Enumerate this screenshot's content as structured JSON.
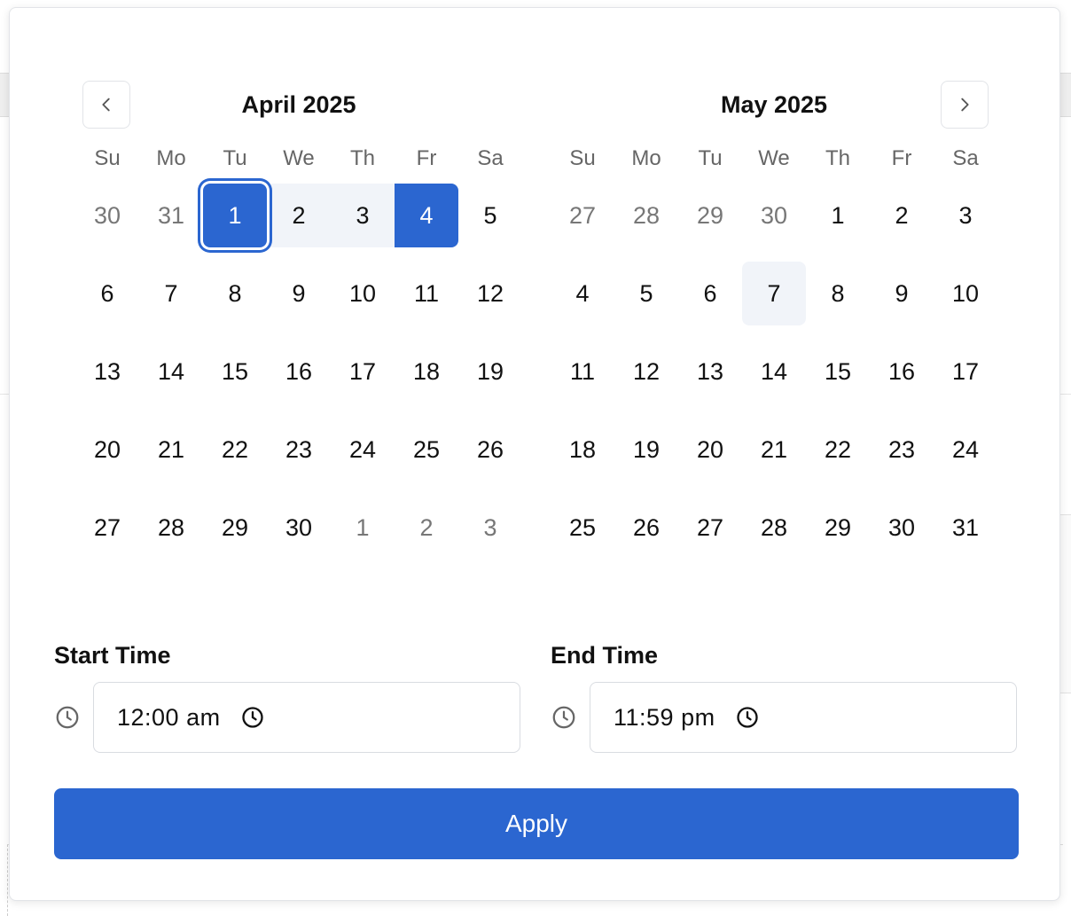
{
  "calendar": {
    "weekdays": [
      "Su",
      "Mo",
      "Tu",
      "We",
      "Th",
      "Fr",
      "Sa"
    ],
    "months": [
      {
        "title": "April 2025",
        "days": [
          {
            "label": "30",
            "state": "outside"
          },
          {
            "label": "31",
            "state": "outside"
          },
          {
            "label": "1",
            "state": "range-start"
          },
          {
            "label": "2",
            "state": "in-range"
          },
          {
            "label": "3",
            "state": "in-range"
          },
          {
            "label": "4",
            "state": "range-end"
          },
          {
            "label": "5",
            "state": ""
          },
          {
            "label": "6",
            "state": ""
          },
          {
            "label": "7",
            "state": ""
          },
          {
            "label": "8",
            "state": ""
          },
          {
            "label": "9",
            "state": ""
          },
          {
            "label": "10",
            "state": ""
          },
          {
            "label": "11",
            "state": ""
          },
          {
            "label": "12",
            "state": ""
          },
          {
            "label": "13",
            "state": ""
          },
          {
            "label": "14",
            "state": ""
          },
          {
            "label": "15",
            "state": ""
          },
          {
            "label": "16",
            "state": ""
          },
          {
            "label": "17",
            "state": ""
          },
          {
            "label": "18",
            "state": ""
          },
          {
            "label": "19",
            "state": ""
          },
          {
            "label": "20",
            "state": ""
          },
          {
            "label": "21",
            "state": ""
          },
          {
            "label": "22",
            "state": ""
          },
          {
            "label": "23",
            "state": ""
          },
          {
            "label": "24",
            "state": ""
          },
          {
            "label": "25",
            "state": ""
          },
          {
            "label": "26",
            "state": ""
          },
          {
            "label": "27",
            "state": ""
          },
          {
            "label": "28",
            "state": ""
          },
          {
            "label": "29",
            "state": ""
          },
          {
            "label": "30",
            "state": ""
          },
          {
            "label": "1",
            "state": "outside"
          },
          {
            "label": "2",
            "state": "outside"
          },
          {
            "label": "3",
            "state": "outside"
          }
        ]
      },
      {
        "title": "May 2025",
        "days": [
          {
            "label": "27",
            "state": "outside"
          },
          {
            "label": "28",
            "state": "outside"
          },
          {
            "label": "29",
            "state": "outside"
          },
          {
            "label": "30",
            "state": "outside"
          },
          {
            "label": "1",
            "state": ""
          },
          {
            "label": "2",
            "state": ""
          },
          {
            "label": "3",
            "state": ""
          },
          {
            "label": "4",
            "state": ""
          },
          {
            "label": "5",
            "state": ""
          },
          {
            "label": "6",
            "state": ""
          },
          {
            "label": "7",
            "state": "today"
          },
          {
            "label": "8",
            "state": ""
          },
          {
            "label": "9",
            "state": ""
          },
          {
            "label": "10",
            "state": ""
          },
          {
            "label": "11",
            "state": ""
          },
          {
            "label": "12",
            "state": ""
          },
          {
            "label": "13",
            "state": ""
          },
          {
            "label": "14",
            "state": ""
          },
          {
            "label": "15",
            "state": ""
          },
          {
            "label": "16",
            "state": ""
          },
          {
            "label": "17",
            "state": ""
          },
          {
            "label": "18",
            "state": ""
          },
          {
            "label": "19",
            "state": ""
          },
          {
            "label": "20",
            "state": ""
          },
          {
            "label": "21",
            "state": ""
          },
          {
            "label": "22",
            "state": ""
          },
          {
            "label": "23",
            "state": ""
          },
          {
            "label": "24",
            "state": ""
          },
          {
            "label": "25",
            "state": ""
          },
          {
            "label": "26",
            "state": ""
          },
          {
            "label": "27",
            "state": ""
          },
          {
            "label": "28",
            "state": ""
          },
          {
            "label": "29",
            "state": ""
          },
          {
            "label": "30",
            "state": ""
          },
          {
            "label": "31",
            "state": ""
          }
        ]
      }
    ]
  },
  "time": {
    "start_label": "Start Time",
    "start_value": "12:00  am",
    "end_label": "End Time",
    "end_value": "11:59  pm"
  },
  "apply_label": "Apply",
  "colors": {
    "accent": "#2b66d0",
    "range_bg": "#f1f4f9",
    "muted_text": "#777777"
  },
  "icons": {
    "prev": "chevron-left-icon",
    "next": "chevron-right-icon",
    "clock": "clock-icon"
  }
}
